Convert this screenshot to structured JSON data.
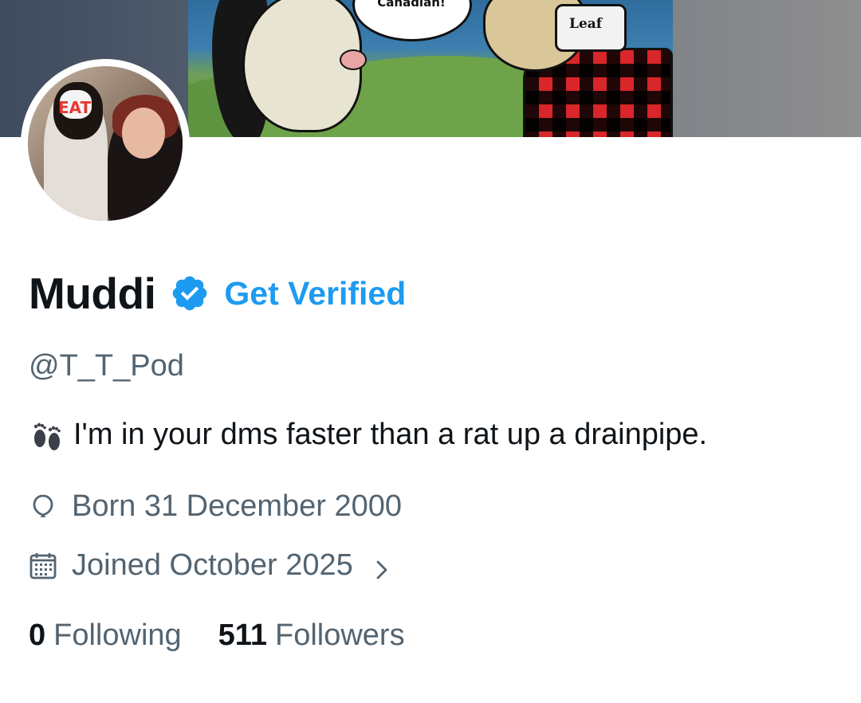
{
  "banner": {
    "speech_text": "Canadian!",
    "cap_text": "Leaf"
  },
  "profile": {
    "display_name": "Muddi",
    "get_verified_label": "Get Verified",
    "handle": "@T_T_Pod",
    "bio": "I'm in your dms faster than a rat up a drainpipe.",
    "bio_emoji": "footprints-icon",
    "avatar_cap_text": "EAT",
    "born": "Born 31 December 2000",
    "joined": "Joined October 2025",
    "following_count": "0",
    "following_label": "Following",
    "followers_count": "511",
    "followers_label": "Followers"
  },
  "colors": {
    "accent": "#1d9bf0",
    "text_primary": "#0f1419",
    "text_secondary": "#536471"
  },
  "icons": {
    "verified": "verified-badge-icon",
    "born": "balloon-icon",
    "joined": "calendar-icon",
    "chevron": "chevron-right-icon"
  }
}
